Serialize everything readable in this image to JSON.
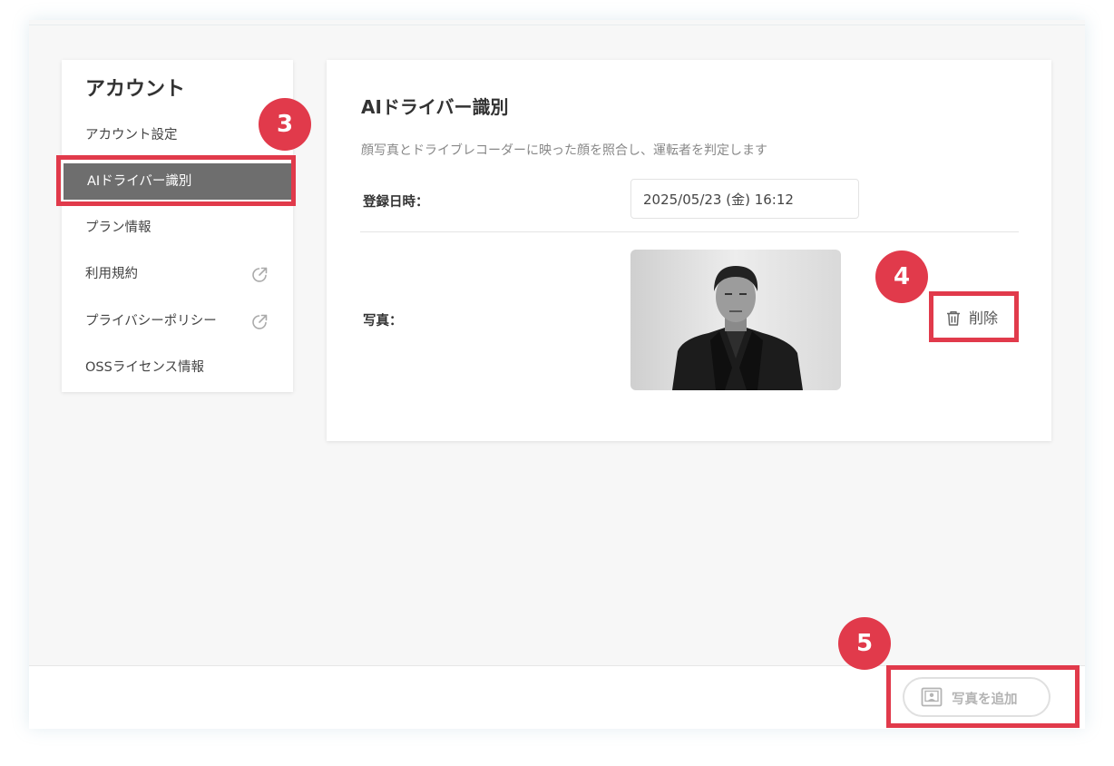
{
  "sidebar": {
    "title": "アカウント",
    "items": [
      {
        "label": "アカウント設定",
        "external": false
      },
      {
        "label": "AIドライバー識別",
        "external": false,
        "active": true
      },
      {
        "label": "プラン情報",
        "external": false
      },
      {
        "label": "利用規約",
        "external": true,
        "icon": "external-link-icon"
      },
      {
        "label": "プライバシーポリシー",
        "external": true,
        "icon": "external-link-icon"
      },
      {
        "label": "OSSライセンス情報",
        "external": false
      }
    ]
  },
  "main": {
    "title": "AIドライバー識別",
    "description": "顔写真とドライブレコーダーに映った顔を照合し、運転者を判定します",
    "registered_label": "登録日時：",
    "registered_value": "2025/05/23 (金) 16:12",
    "photo_label": "写真：",
    "delete_label": "削除",
    "delete_icon": "trash-icon"
  },
  "footer": {
    "add_photo_label": "写真を追加",
    "add_photo_icon": "portrait-icon"
  },
  "annotations": {
    "badges": [
      "3",
      "4",
      "5"
    ],
    "color": "#e13a4b"
  }
}
